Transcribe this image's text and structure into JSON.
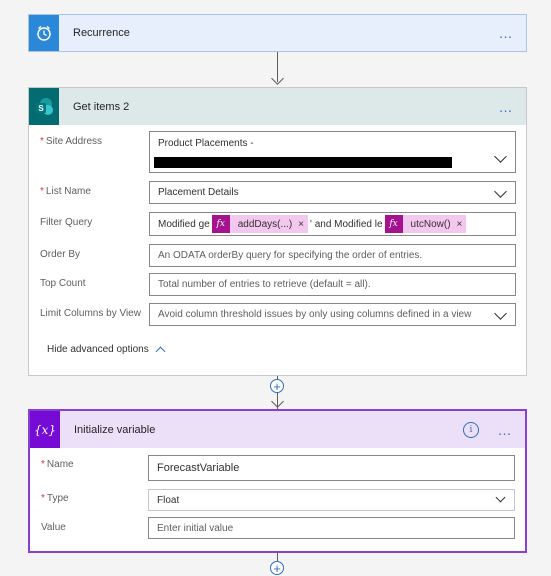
{
  "recurrence": {
    "title": "Recurrence",
    "icon": "alarm-clock-icon",
    "more": "…"
  },
  "get_items": {
    "title": "Get items 2",
    "icon": "sharepoint-icon",
    "more": "…",
    "site_address": {
      "label": "Site Address",
      "value": "Product Placements -"
    },
    "list_name": {
      "label": "List Name",
      "value": "Placement Details"
    },
    "filter_query": {
      "label": "Filter Query",
      "text1": "Modified ge",
      "token1": "addDays(...)",
      "text2": "' and Modified le",
      "token2": "utcNow()",
      "token_icon": "fx",
      "remove": "×"
    },
    "order_by": {
      "label": "Order By",
      "placeholder": "An ODATA orderBy query for specifying the order of entries."
    },
    "top_count": {
      "label": "Top Count",
      "placeholder": "Total number of entries to retrieve (default = all)."
    },
    "limit_columns": {
      "label": "Limit Columns by View",
      "placeholder": "Avoid column threshold issues by only using columns defined in a view"
    },
    "hide_advanced": "Hide advanced options"
  },
  "init_variable": {
    "title": "Initialize variable",
    "icon_text": "{x}",
    "info": "i",
    "more": "…",
    "name": {
      "label": "Name",
      "value": "ForecastVariable"
    },
    "type": {
      "label": "Type",
      "value": "Float"
    },
    "value": {
      "label": "Value",
      "placeholder": "Enter initial value"
    }
  },
  "add_step": "+",
  "colors": {
    "recurrence_header": "#e6effb",
    "recurrence_icon": "#2b88d8",
    "sharepoint_header": "#dde9e9",
    "sharepoint_icon": "#036c70",
    "variable_header": "#ecdff8",
    "variable_icon": "#770bd6",
    "token_bg": "#f4c7ef",
    "token_icon": "#a4128f",
    "link_blue": "#2f6fbf"
  }
}
